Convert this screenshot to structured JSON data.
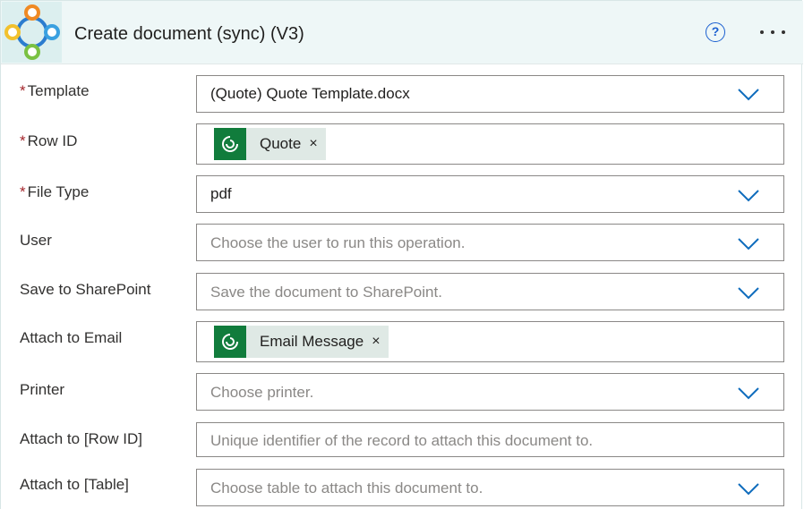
{
  "header": {
    "title": "Create document (sync) (V3)",
    "help_label": "?"
  },
  "fields": {
    "template": {
      "label": "Template",
      "required_mark": "*",
      "value": "(Quote) Quote Template.docx"
    },
    "row_id": {
      "label": "Row ID",
      "required_mark": "*",
      "token": "Quote",
      "token_remove": "×"
    },
    "file_type": {
      "label": "File Type",
      "required_mark": "*",
      "value": "pdf"
    },
    "user": {
      "label": "User",
      "placeholder": "Choose the user to run this operation."
    },
    "save_to_sharepoint": {
      "label": "Save to SharePoint",
      "placeholder": "Save the document to SharePoint."
    },
    "attach_to_email": {
      "label": "Attach to Email",
      "token": "Email Message",
      "token_remove": "×"
    },
    "printer": {
      "label": "Printer",
      "placeholder": "Choose printer."
    },
    "attach_to_row_id": {
      "label": "Attach to [Row ID]",
      "placeholder": "Unique identifier of the record to attach this document to."
    },
    "attach_to_table": {
      "label": "Attach to [Table]",
      "placeholder": "Choose table to attach this document to."
    }
  },
  "colors": {
    "accent": "#0f6cbd",
    "token_icon_bg": "#117c3c",
    "token_bg": "#dfe9e5",
    "required": "#a4262c",
    "header_bg": "#eef7f7"
  },
  "icons": {
    "app": "connector-logo-icon",
    "help": "help-circle-icon",
    "more": "more-options-icon",
    "dropdown": "chevron-down-icon",
    "token": "dataverse-icon"
  }
}
